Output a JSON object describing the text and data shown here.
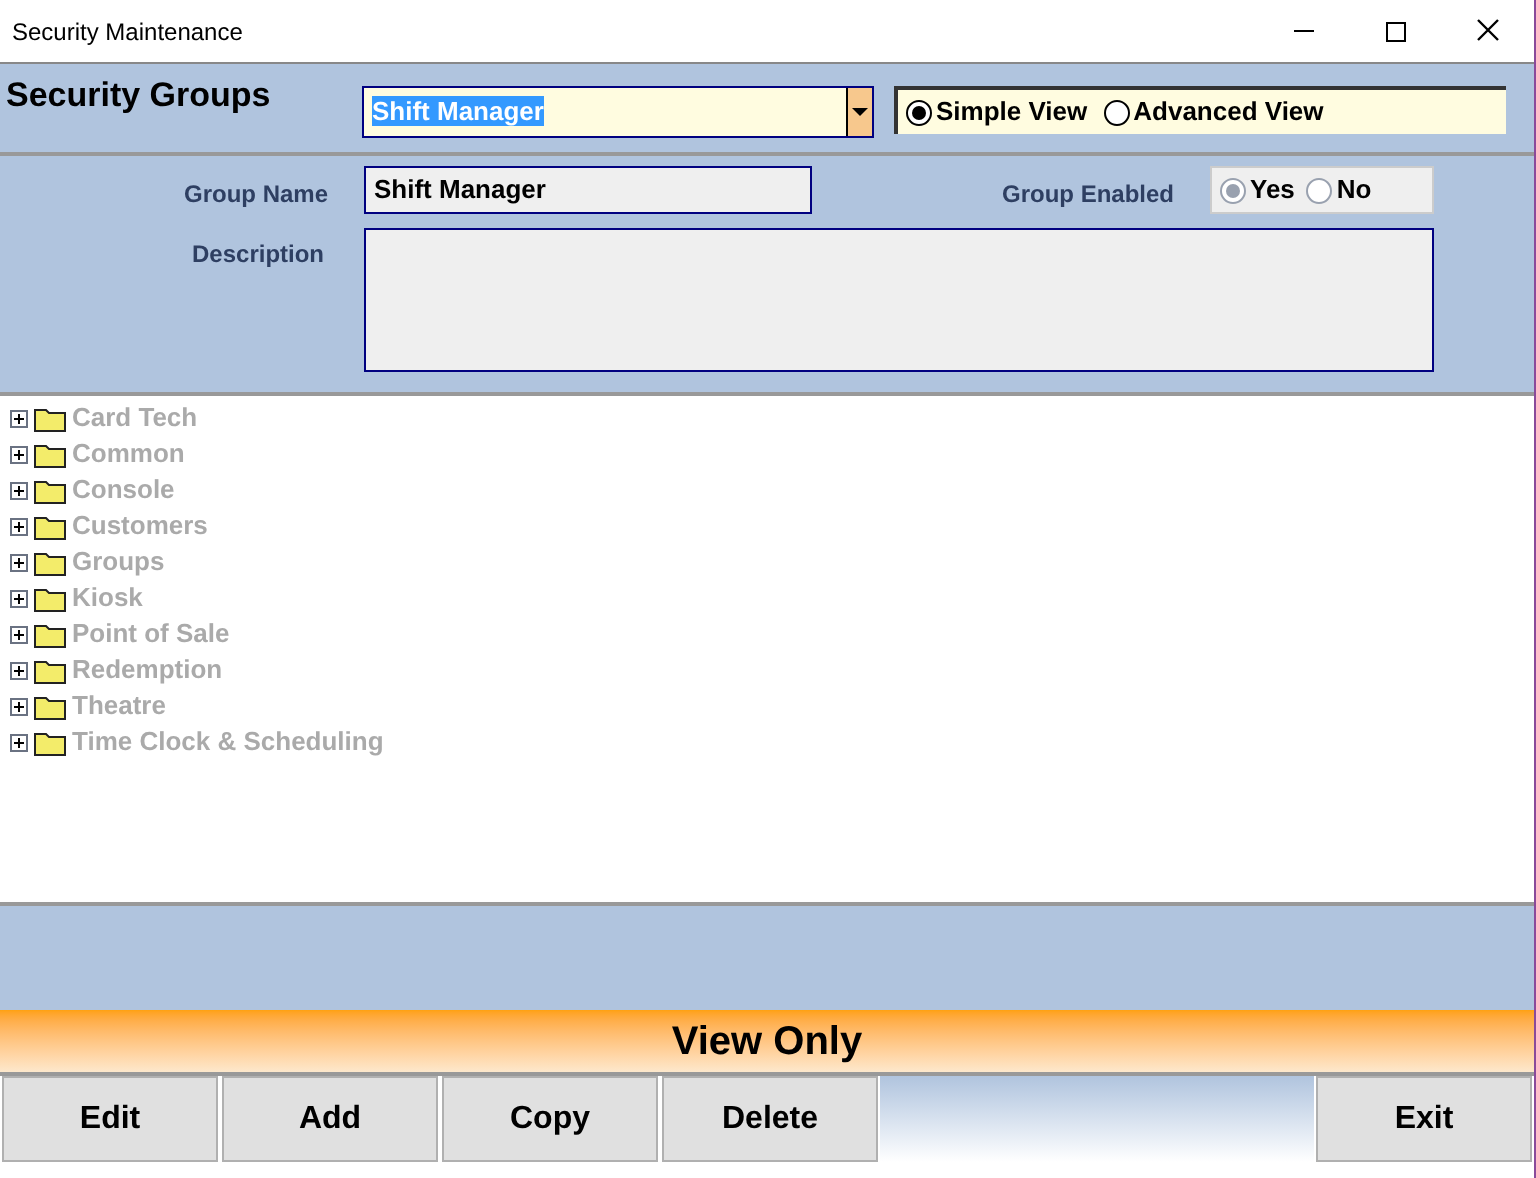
{
  "window": {
    "title": "Security Maintenance"
  },
  "header": {
    "title": "Security Groups",
    "group_select": {
      "value": "Shift Manager"
    },
    "view_options": [
      {
        "label": "Simple View",
        "selected": true
      },
      {
        "label": "Advanced View",
        "selected": false
      }
    ]
  },
  "details": {
    "group_name_label": "Group Name",
    "group_name": "Shift Manager",
    "enabled_label": "Group Enabled",
    "enabled_disabled": true,
    "enabled_options": [
      {
        "label": "Yes",
        "selected": true
      },
      {
        "label": "No",
        "selected": false
      }
    ],
    "description_label": "Description"
  },
  "tree": [
    {
      "label": "Card Tech"
    },
    {
      "label": "Common"
    },
    {
      "label": "Console"
    },
    {
      "label": "Customers"
    },
    {
      "label": "Groups"
    },
    {
      "label": "Kiosk"
    },
    {
      "label": "Point of Sale"
    },
    {
      "label": "Redemption"
    },
    {
      "label": "Theatre"
    },
    {
      "label": "Time Clock & Scheduling"
    }
  ],
  "banner": "View Only",
  "buttons": [
    "Edit",
    "Add",
    "Copy",
    "Delete"
  ],
  "exit_button": "Exit"
}
